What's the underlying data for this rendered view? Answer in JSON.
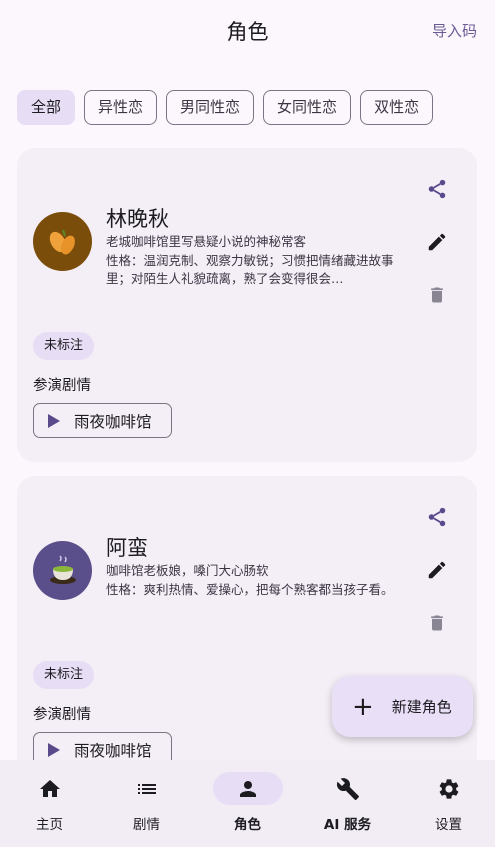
{
  "header": {
    "title": "角色",
    "import_label": "导入码"
  },
  "filters": [
    {
      "label": "全部",
      "active": true
    },
    {
      "label": "异性恋",
      "active": false
    },
    {
      "label": "男同性恋",
      "active": false
    },
    {
      "label": "女同性恋",
      "active": false
    },
    {
      "label": "双性恋",
      "active": false
    }
  ],
  "characters": [
    {
      "name": "林晚秋",
      "avatar_icon": "sweet-potato-icon",
      "avatar_color": "#7a4d0a",
      "tagline": "老城咖啡馆里写悬疑小说的神秘常客",
      "personality": "性格：温润克制、观察力敏锐；习惯把情绪藏进故事里；对陌生人礼貌疏离，熟了会变得很会…",
      "tag": "未标注",
      "stories_label": "参演剧情",
      "story": "雨夜咖啡馆"
    },
    {
      "name": "阿蛮",
      "avatar_icon": "tea-cup-icon",
      "avatar_color": "#5a4f8a",
      "tagline": "咖啡馆老板娘，嗓门大心肠软",
      "personality": "性格：爽利热情、爱操心，把每个熟客都当孩子看。",
      "tag": "未标注",
      "stories_label": "参演剧情",
      "story": "雨夜咖啡馆"
    }
  ],
  "fab": {
    "label": "新建角色"
  },
  "nav": [
    {
      "label": "主页",
      "icon": "home-icon",
      "active": false
    },
    {
      "label": "剧情",
      "icon": "list-icon",
      "active": false
    },
    {
      "label": "角色",
      "icon": "person-icon",
      "active": true
    },
    {
      "label": "AI 服务",
      "icon": "wrench-icon",
      "active": false
    },
    {
      "label": "设置",
      "icon": "gear-icon",
      "active": false
    }
  ],
  "colors": {
    "accent": "#e7def6",
    "primary": "#5b4a8b",
    "background": "#fcf7fd",
    "card": "#f4eef6"
  }
}
